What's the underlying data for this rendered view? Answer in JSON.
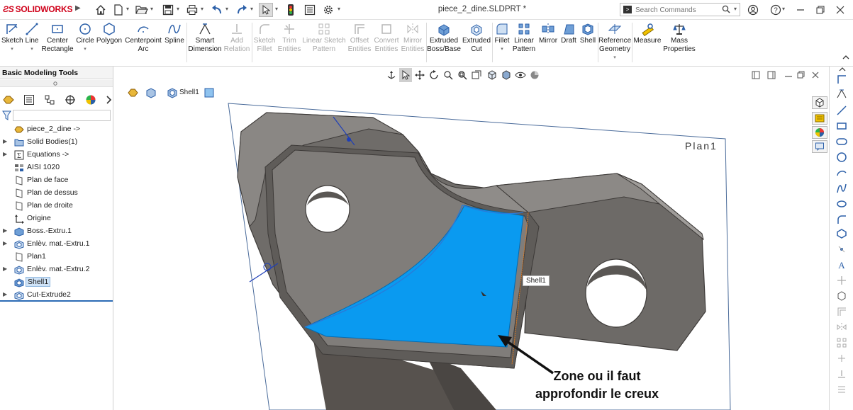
{
  "app": {
    "logo_prefix": "ƧS",
    "logo_text": "SOLIDWORKS",
    "document_title": "piece_2_dine.SLDPRT *"
  },
  "search": {
    "placeholder": "Search Commands"
  },
  "commands": [
    {
      "key": "sketch",
      "label": "Sketch",
      "enabled": true
    },
    {
      "key": "line",
      "label": "Line",
      "enabled": true
    },
    {
      "key": "center-rectangle",
      "label": "Center\nRectangle",
      "enabled": true
    },
    {
      "key": "circle",
      "label": "Circle",
      "enabled": true
    },
    {
      "key": "polygon",
      "label": "Polygon",
      "enabled": true
    },
    {
      "key": "centerpoint-arc",
      "label": "Centerpoint\nArc",
      "enabled": true
    },
    {
      "key": "spline",
      "label": "Spline",
      "enabled": true
    },
    {
      "key": "smart-dimension",
      "label": "Smart\nDimension",
      "enabled": true
    },
    {
      "key": "add-relation",
      "label": "Add\nRelation",
      "enabled": false
    },
    {
      "key": "sketch-fillet",
      "label": "Sketch\nFillet",
      "enabled": false
    },
    {
      "key": "trim-entities",
      "label": "Trim\nEntities",
      "enabled": false
    },
    {
      "key": "linear-sketch-pattern",
      "label": "Linear Sketch\nPattern",
      "enabled": false
    },
    {
      "key": "offset-entities",
      "label": "Offset\nEntities",
      "enabled": false
    },
    {
      "key": "convert-entities",
      "label": "Convert\nEntities",
      "enabled": false
    },
    {
      "key": "mirror-entities",
      "label": "Mirror\nEntities",
      "enabled": false
    },
    {
      "key": "extruded-boss-base",
      "label": "Extruded\nBoss/Base",
      "enabled": true
    },
    {
      "key": "extruded-cut",
      "label": "Extruded\nCut",
      "enabled": true
    },
    {
      "key": "fillet",
      "label": "Fillet",
      "enabled": true
    },
    {
      "key": "linear-pattern",
      "label": "Linear\nPattern",
      "enabled": true
    },
    {
      "key": "mirror",
      "label": "Mirror",
      "enabled": true
    },
    {
      "key": "draft",
      "label": "Draft",
      "enabled": true
    },
    {
      "key": "shell",
      "label": "Shell",
      "enabled": true
    },
    {
      "key": "reference-geometry",
      "label": "Reference\nGeometry",
      "enabled": true
    },
    {
      "key": "measure",
      "label": "Measure",
      "enabled": true
    },
    {
      "key": "mass-properties",
      "label": "Mass\nProperties",
      "enabled": true
    }
  ],
  "left_panel": {
    "tab_title": "Basic Modeling Tools"
  },
  "tree": [
    {
      "label": "piece_2_dine ->",
      "icon": "part-icon",
      "expandable": false,
      "selected": false
    },
    {
      "label": "Solid Bodies(1)",
      "icon": "solid-bodies-folder-icon",
      "expandable": true,
      "selected": false
    },
    {
      "label": "Equations ->",
      "icon": "equations-icon",
      "expandable": true,
      "selected": false
    },
    {
      "label": "AISI 1020",
      "icon": "material-icon",
      "expandable": false,
      "selected": false
    },
    {
      "label": "Plan de face",
      "icon": "plane-icon",
      "expandable": false,
      "selected": false
    },
    {
      "label": "Plan de dessus",
      "icon": "plane-icon",
      "expandable": false,
      "selected": false
    },
    {
      "label": "Plan de droite",
      "icon": "plane-icon",
      "expandable": false,
      "selected": false
    },
    {
      "label": "Origine",
      "icon": "origin-icon",
      "expandable": false,
      "selected": false
    },
    {
      "label": "Boss.-Extru.1",
      "icon": "extrude-boss-icon",
      "expandable": true,
      "selected": false
    },
    {
      "label": "Enlèv. mat.-Extru.1",
      "icon": "extrude-cut-icon",
      "expandable": true,
      "selected": false
    },
    {
      "label": "Plan1",
      "icon": "plane-icon",
      "expandable": false,
      "selected": false
    },
    {
      "label": "Enlèv. mat.-Extru.2",
      "icon": "extrude-cut-icon",
      "expandable": true,
      "selected": false
    },
    {
      "label": "Shell1",
      "icon": "shell-icon",
      "expandable": false,
      "selected": true
    },
    {
      "label": "Cut-Extrude2",
      "icon": "extrude-cut-icon",
      "expandable": true,
      "selected": false
    }
  ],
  "viewport": {
    "breadcrumb_label": "Shell1",
    "plane_label": "Plan1",
    "tooltip": "Shell1",
    "annotation_line1": "Zone ou il faut",
    "annotation_line2": "approfondir le creux"
  },
  "colors": {
    "brand": "#d0021b",
    "selected_face": "#0a9af0",
    "body": "#7d7b78"
  }
}
